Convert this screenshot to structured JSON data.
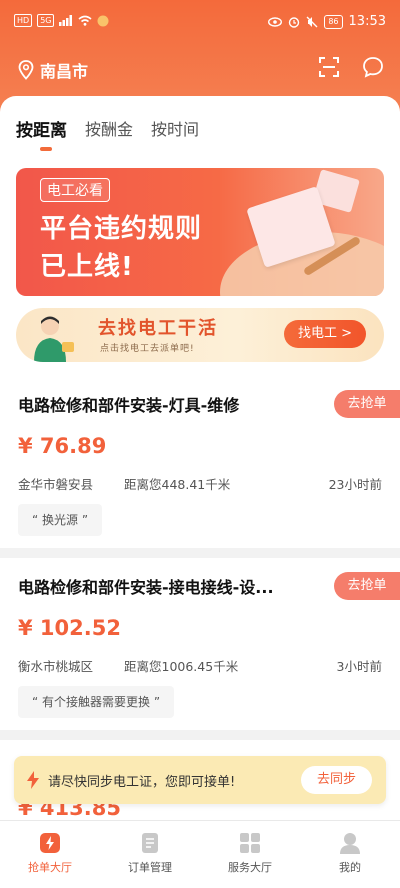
{
  "status_bar": {
    "left_icons": [
      "HD",
      "5G"
    ],
    "time": "13:53",
    "battery": "86"
  },
  "header": {
    "city": "南昌市",
    "icons": [
      "location-pin-icon",
      "scan-icon",
      "message-icon"
    ]
  },
  "tabs": [
    {
      "label": "按距离",
      "active": true
    },
    {
      "label": "按酬金",
      "active": false
    },
    {
      "label": "按时间",
      "active": false
    }
  ],
  "banner": {
    "tag": "电工必看",
    "line1": "平台违约规则",
    "line2": "已上线!"
  },
  "strip_banner": {
    "title": "去找电工干活",
    "subtitle": "点击找电工去派单吧!",
    "button": "找电工 >"
  },
  "orders": [
    {
      "title": "电路检修和部件安装-灯具-维修",
      "grab": "去抢单",
      "price": "¥ 76.89",
      "location": "金华市磐安县",
      "distance": "距离您448.41千米",
      "time": "23小时前",
      "note": "“ 换光源 ”"
    },
    {
      "title": "电路检修和部件安装-接电接线-设...",
      "grab": "去抢单",
      "price": "¥ 102.52",
      "location": "衡水市桃城区",
      "distance": "距离您1006.45千米",
      "time": "3小时前",
      "note": "“ 有个接触器需要更换 ”"
    },
    {
      "price": "¥ 413.85"
    }
  ],
  "notice": {
    "text": "请尽快同步电工证，您即可接单!",
    "button": "去同步"
  },
  "bottom_nav": [
    {
      "label": "抢单大厅",
      "icon": "grab-hall-icon",
      "active": true
    },
    {
      "label": "订单管理",
      "icon": "order-icon",
      "active": false
    },
    {
      "label": "服务大厅",
      "icon": "service-grid-icon",
      "active": false
    },
    {
      "label": "我的",
      "icon": "profile-icon",
      "active": false
    }
  ],
  "colors": {
    "brand": "#f46a3b",
    "price": "#f2613b",
    "notice_bg": "#fbeab4"
  }
}
